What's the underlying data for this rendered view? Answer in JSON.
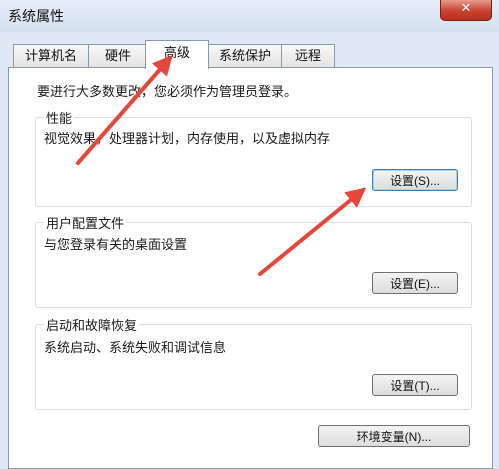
{
  "window": {
    "title": "系统属性",
    "close_glyph": "✕"
  },
  "tabs": [
    {
      "label": "计算机名"
    },
    {
      "label": "硬件"
    },
    {
      "label": "高级",
      "active": true
    },
    {
      "label": "系统保护"
    },
    {
      "label": "远程"
    }
  ],
  "admin_note": "要进行大多数更改，您必须作为管理员登录。",
  "performance": {
    "title": "性能",
    "desc": "视觉效果，处理器计划，内存使用，以及虚拟内存",
    "button": "设置(S)..."
  },
  "user_profiles": {
    "title": "用户配置文件",
    "desc": "与您登录有关的桌面设置",
    "button": "设置(E)..."
  },
  "startup_recovery": {
    "title": "启动和故障恢复",
    "desc": "系统启动、系统失败和调试信息",
    "button": "设置(T)..."
  },
  "env_button": "环境变量(N)...",
  "colors": {
    "annotation_arrow": "#e8463a",
    "panel_bg": "#ffffff",
    "window_bg": "#dfe9f5"
  }
}
